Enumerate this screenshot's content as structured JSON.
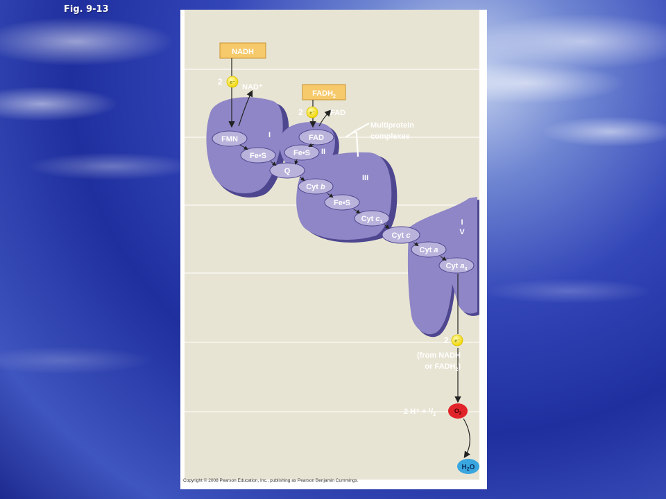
{
  "slide": {
    "title": "Fig. 9-13"
  },
  "figure": {
    "carriers": {
      "nadh": "NADH",
      "nad_plus": "NAD⁺",
      "fadh2_base": "FADH",
      "fadh2_sub": "2",
      "fad_out": "FAD",
      "fmn": "FMN",
      "fes_1": "Fe•S",
      "fad_complex": "FAD",
      "fes_2": "Fe•S",
      "q": "Q",
      "cyt_b_prefix": "Cyt ",
      "cyt_b_letter": "b",
      "fes_3": "Fe•S",
      "cyt_c1_prefix": "Cyt ",
      "cyt_c1_letter": "c",
      "cyt_c1_sub": "1",
      "cyt_c_prefix": "Cyt ",
      "cyt_c_letter": "c",
      "cyt_a_prefix": "Cyt ",
      "cyt_a_letter": "a",
      "cyt_a3_prefix": "Cyt ",
      "cyt_a3_letter": "a",
      "cyt_a3_sub": "3"
    },
    "complexes": {
      "i": "I",
      "ii": "II",
      "iii": "III",
      "iv_line1": "I",
      "iv_line2": "V",
      "multiprotein_line1": "Multiprotein",
      "multiprotein_line2": "complexes"
    },
    "electrons": {
      "count": "2",
      "symbol": "e⁻"
    },
    "source_note": {
      "line1": "(from NADH",
      "line2_base": "or FADH",
      "line2_sub": "2",
      "line2_end": ")"
    },
    "oxygen_eq": {
      "prefix": "2 H⁺ + ¹/",
      "half_sub": "2",
      "o2_base": "O",
      "o2_sub": "2"
    },
    "water": {
      "base": "H",
      "sub": "2",
      "end": "O"
    },
    "copyright": "Copyright © 2008 Pearson Education, Inc., publishing as Pearson Benjamin Cummings.",
    "colors": {
      "panel_bg": "#e8e4d3",
      "complex_fill": "#8e86c6",
      "complex_edge": "#4e4790",
      "carrier_fill": "#b9b3dc",
      "box_fill": "#f6c96b",
      "electron": "#f7e41d",
      "oxygen": "#e0242a",
      "water": "#3aa6df"
    }
  }
}
